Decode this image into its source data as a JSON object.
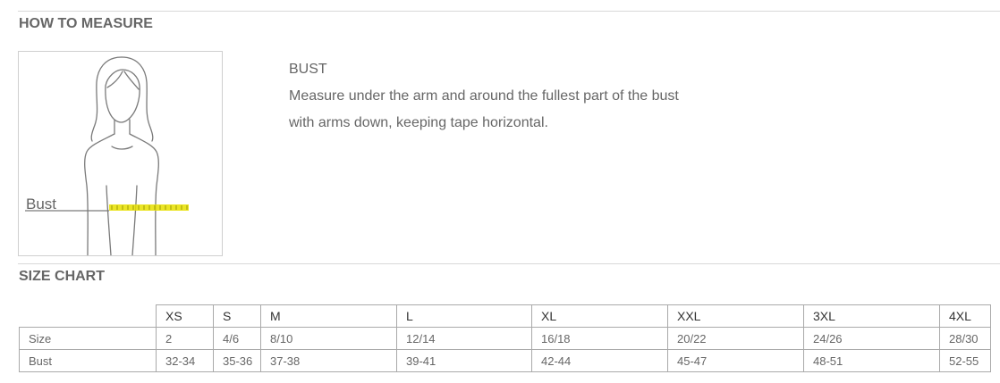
{
  "how_to_measure": {
    "title": "HOW TO MEASURE",
    "figure_label": "Bust",
    "heading": "BUST",
    "line1": "Measure under the arm and around the fullest part of the bust",
    "line2": "with arms down, keeping tape horizontal."
  },
  "size_chart": {
    "title": "SIZE CHART",
    "sizes": [
      "XS",
      "S",
      "M",
      "L",
      "XL",
      "XXL",
      "3XL",
      "4XL"
    ],
    "rows": [
      {
        "label": "Size",
        "values": [
          "2",
          "4/6",
          "8/10",
          "12/14",
          "16/18",
          "20/22",
          "24/26",
          "28/30"
        ]
      },
      {
        "label": "Bust",
        "values": [
          "32-34",
          "35-36",
          "37-38",
          "39-41",
          "42-44",
          "45-47",
          "48-51",
          "52-55"
        ]
      }
    ]
  },
  "colors": {
    "tape": "#e8e000",
    "border": "#a9a9a9",
    "divider": "#d8d8d8"
  }
}
